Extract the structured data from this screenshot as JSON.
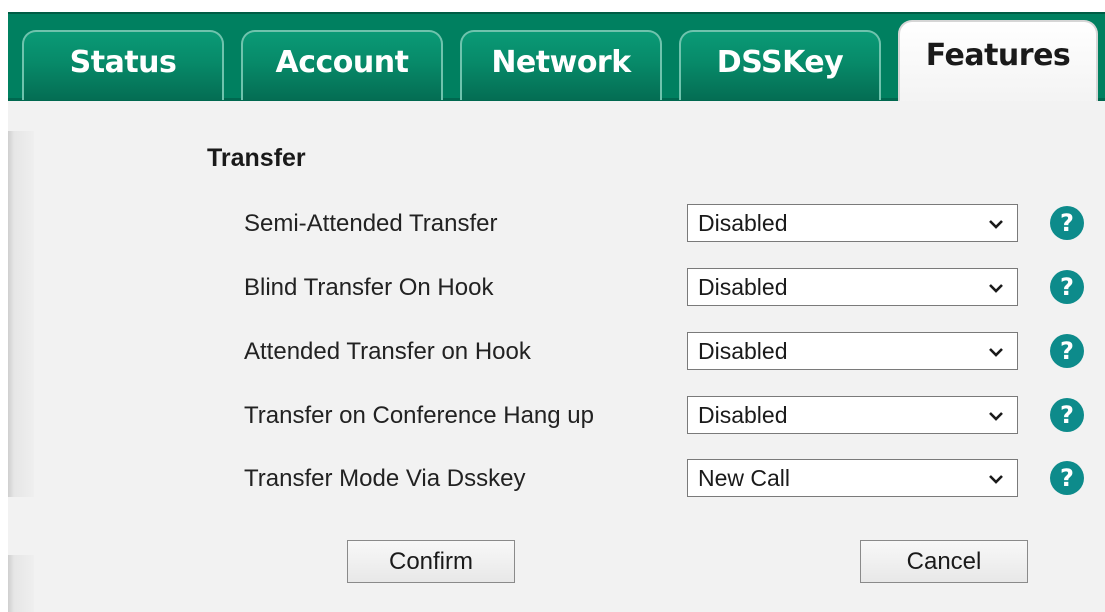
{
  "tabs": [
    {
      "label": "Status",
      "active": false
    },
    {
      "label": "Account",
      "active": false
    },
    {
      "label": "Network",
      "active": false
    },
    {
      "label": "DSSKey",
      "active": false
    },
    {
      "label": "Features",
      "active": true
    }
  ],
  "section": {
    "title": "Transfer"
  },
  "settings": [
    {
      "label": "Semi-Attended Transfer",
      "value": "Disabled",
      "help_icon": "question-mark"
    },
    {
      "label": "Blind Transfer On Hook",
      "value": "Disabled",
      "help_icon": "question-mark"
    },
    {
      "label": "Attended Transfer on Hook",
      "value": "Disabled",
      "help_icon": "question-mark"
    },
    {
      "label": "Transfer on Conference Hang up",
      "value": "Disabled",
      "help_icon": "question-mark"
    },
    {
      "label": "Transfer Mode Via Dsskey",
      "value": "New Call",
      "help_icon": "question-mark"
    }
  ],
  "help_glyph": "?",
  "buttons": {
    "confirm": "Confirm",
    "cancel": "Cancel"
  },
  "colors": {
    "tab_green": "#008060",
    "help_teal": "#0d8b8b",
    "panel_bg": "#f2f2f2"
  }
}
